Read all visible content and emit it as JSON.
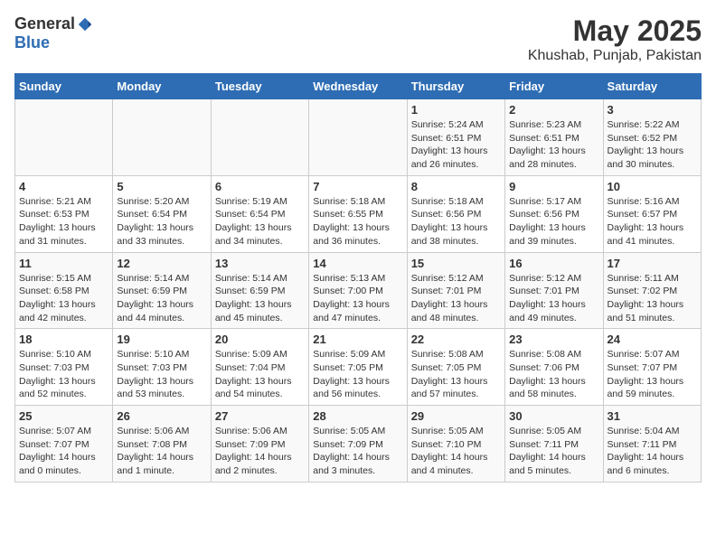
{
  "logo": {
    "text_general": "General",
    "text_blue": "Blue"
  },
  "title": "May 2025",
  "subtitle": "Khushab, Punjab, Pakistan",
  "header": {
    "days": [
      "Sunday",
      "Monday",
      "Tuesday",
      "Wednesday",
      "Thursday",
      "Friday",
      "Saturday"
    ]
  },
  "weeks": [
    {
      "days": [
        {
          "num": "",
          "detail": ""
        },
        {
          "num": "",
          "detail": ""
        },
        {
          "num": "",
          "detail": ""
        },
        {
          "num": "",
          "detail": ""
        },
        {
          "num": "1",
          "detail": "Sunrise: 5:24 AM\nSunset: 6:51 PM\nDaylight: 13 hours\nand 26 minutes."
        },
        {
          "num": "2",
          "detail": "Sunrise: 5:23 AM\nSunset: 6:51 PM\nDaylight: 13 hours\nand 28 minutes."
        },
        {
          "num": "3",
          "detail": "Sunrise: 5:22 AM\nSunset: 6:52 PM\nDaylight: 13 hours\nand 30 minutes."
        }
      ]
    },
    {
      "days": [
        {
          "num": "4",
          "detail": "Sunrise: 5:21 AM\nSunset: 6:53 PM\nDaylight: 13 hours\nand 31 minutes."
        },
        {
          "num": "5",
          "detail": "Sunrise: 5:20 AM\nSunset: 6:54 PM\nDaylight: 13 hours\nand 33 minutes."
        },
        {
          "num": "6",
          "detail": "Sunrise: 5:19 AM\nSunset: 6:54 PM\nDaylight: 13 hours\nand 34 minutes."
        },
        {
          "num": "7",
          "detail": "Sunrise: 5:18 AM\nSunset: 6:55 PM\nDaylight: 13 hours\nand 36 minutes."
        },
        {
          "num": "8",
          "detail": "Sunrise: 5:18 AM\nSunset: 6:56 PM\nDaylight: 13 hours\nand 38 minutes."
        },
        {
          "num": "9",
          "detail": "Sunrise: 5:17 AM\nSunset: 6:56 PM\nDaylight: 13 hours\nand 39 minutes."
        },
        {
          "num": "10",
          "detail": "Sunrise: 5:16 AM\nSunset: 6:57 PM\nDaylight: 13 hours\nand 41 minutes."
        }
      ]
    },
    {
      "days": [
        {
          "num": "11",
          "detail": "Sunrise: 5:15 AM\nSunset: 6:58 PM\nDaylight: 13 hours\nand 42 minutes."
        },
        {
          "num": "12",
          "detail": "Sunrise: 5:14 AM\nSunset: 6:59 PM\nDaylight: 13 hours\nand 44 minutes."
        },
        {
          "num": "13",
          "detail": "Sunrise: 5:14 AM\nSunset: 6:59 PM\nDaylight: 13 hours\nand 45 minutes."
        },
        {
          "num": "14",
          "detail": "Sunrise: 5:13 AM\nSunset: 7:00 PM\nDaylight: 13 hours\nand 47 minutes."
        },
        {
          "num": "15",
          "detail": "Sunrise: 5:12 AM\nSunset: 7:01 PM\nDaylight: 13 hours\nand 48 minutes."
        },
        {
          "num": "16",
          "detail": "Sunrise: 5:12 AM\nSunset: 7:01 PM\nDaylight: 13 hours\nand 49 minutes."
        },
        {
          "num": "17",
          "detail": "Sunrise: 5:11 AM\nSunset: 7:02 PM\nDaylight: 13 hours\nand 51 minutes."
        }
      ]
    },
    {
      "days": [
        {
          "num": "18",
          "detail": "Sunrise: 5:10 AM\nSunset: 7:03 PM\nDaylight: 13 hours\nand 52 minutes."
        },
        {
          "num": "19",
          "detail": "Sunrise: 5:10 AM\nSunset: 7:03 PM\nDaylight: 13 hours\nand 53 minutes."
        },
        {
          "num": "20",
          "detail": "Sunrise: 5:09 AM\nSunset: 7:04 PM\nDaylight: 13 hours\nand 54 minutes."
        },
        {
          "num": "21",
          "detail": "Sunrise: 5:09 AM\nSunset: 7:05 PM\nDaylight: 13 hours\nand 56 minutes."
        },
        {
          "num": "22",
          "detail": "Sunrise: 5:08 AM\nSunset: 7:05 PM\nDaylight: 13 hours\nand 57 minutes."
        },
        {
          "num": "23",
          "detail": "Sunrise: 5:08 AM\nSunset: 7:06 PM\nDaylight: 13 hours\nand 58 minutes."
        },
        {
          "num": "24",
          "detail": "Sunrise: 5:07 AM\nSunset: 7:07 PM\nDaylight: 13 hours\nand 59 minutes."
        }
      ]
    },
    {
      "days": [
        {
          "num": "25",
          "detail": "Sunrise: 5:07 AM\nSunset: 7:07 PM\nDaylight: 14 hours\nand 0 minutes."
        },
        {
          "num": "26",
          "detail": "Sunrise: 5:06 AM\nSunset: 7:08 PM\nDaylight: 14 hours\nand 1 minute."
        },
        {
          "num": "27",
          "detail": "Sunrise: 5:06 AM\nSunset: 7:09 PM\nDaylight: 14 hours\nand 2 minutes."
        },
        {
          "num": "28",
          "detail": "Sunrise: 5:05 AM\nSunset: 7:09 PM\nDaylight: 14 hours\nand 3 minutes."
        },
        {
          "num": "29",
          "detail": "Sunrise: 5:05 AM\nSunset: 7:10 PM\nDaylight: 14 hours\nand 4 minutes."
        },
        {
          "num": "30",
          "detail": "Sunrise: 5:05 AM\nSunset: 7:11 PM\nDaylight: 14 hours\nand 5 minutes."
        },
        {
          "num": "31",
          "detail": "Sunrise: 5:04 AM\nSunset: 7:11 PM\nDaylight: 14 hours\nand 6 minutes."
        }
      ]
    }
  ]
}
